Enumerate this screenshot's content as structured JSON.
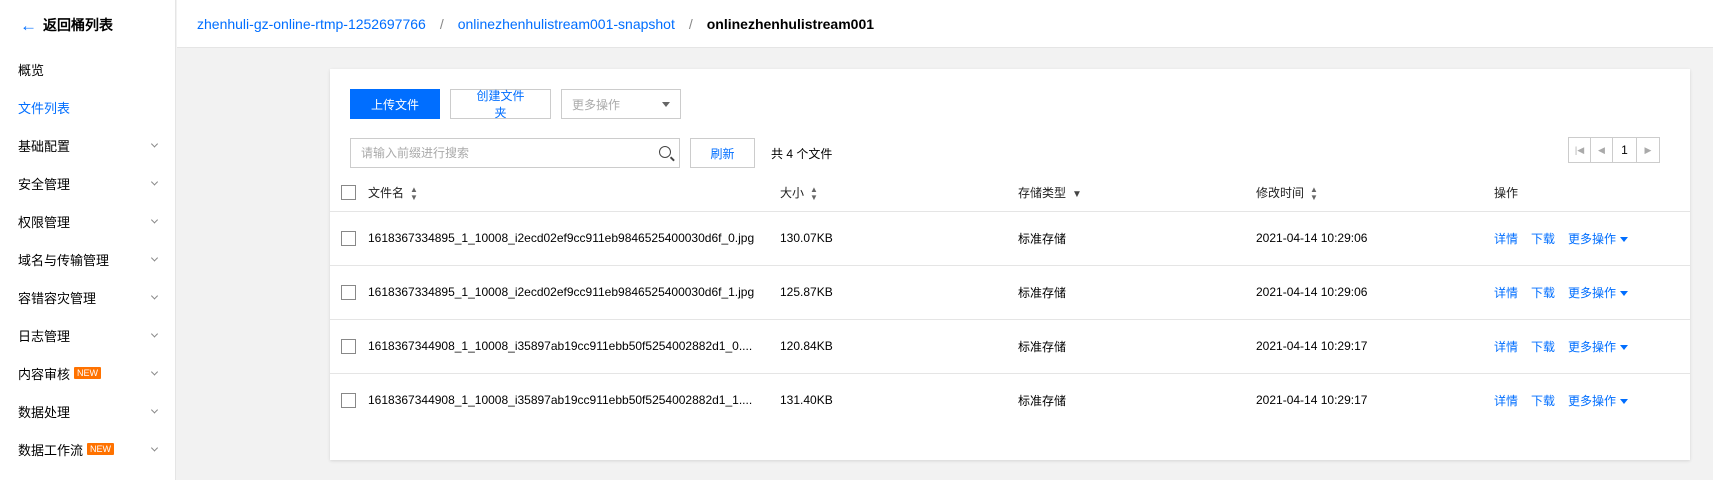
{
  "sidebar": {
    "back_label": "返回桶列表",
    "items": [
      {
        "label": "概览",
        "active": false,
        "expandable": false
      },
      {
        "label": "文件列表",
        "active": true,
        "expandable": false
      },
      {
        "label": "基础配置",
        "active": false,
        "expandable": true
      },
      {
        "label": "安全管理",
        "active": false,
        "expandable": true
      },
      {
        "label": "权限管理",
        "active": false,
        "expandable": true
      },
      {
        "label": "域名与传输管理",
        "active": false,
        "expandable": true
      },
      {
        "label": "容错容灾管理",
        "active": false,
        "expandable": true
      },
      {
        "label": "日志管理",
        "active": false,
        "expandable": true
      },
      {
        "label": "内容审核",
        "active": false,
        "expandable": true,
        "badge": "NEW"
      },
      {
        "label": "数据处理",
        "active": false,
        "expandable": true
      },
      {
        "label": "数据工作流",
        "active": false,
        "expandable": true,
        "badge": "NEW"
      }
    ]
  },
  "breadcrumb": {
    "bucket": "zhenhuli-gz-online-rtmp-1252697766",
    "folder": "onlinezhenhulistream001-snapshot",
    "current": "onlinezhenhulistream001",
    "separator": "/"
  },
  "toolbar": {
    "upload_label": "上传文件",
    "create_folder_label": "创建文件夹",
    "more_ops_placeholder": "更多操作",
    "search_placeholder": "请输入前缀进行搜索",
    "refresh_label": "刷新",
    "file_count_text": "共 4 个文件"
  },
  "pagination": {
    "page": "1"
  },
  "table": {
    "headers": {
      "name": "文件名",
      "size": "大小",
      "storage": "存储类型",
      "modified": "修改时间",
      "actions": "操作"
    },
    "rows": [
      {
        "name": "1618367334895_1_10008_i2ecd02ef9cc911eb9846525400030d6f_0.jpg",
        "size": "130.07KB",
        "storage": "标准存储",
        "modified": "2021-04-14 10:29:06"
      },
      {
        "name": "1618367334895_1_10008_i2ecd02ef9cc911eb9846525400030d6f_1.jpg",
        "size": "125.87KB",
        "storage": "标准存储",
        "modified": "2021-04-14 10:29:06"
      },
      {
        "name": "1618367344908_1_10008_i35897ab19cc911ebb50f5254002882d1_0....",
        "size": "120.84KB",
        "storage": "标准存储",
        "modified": "2021-04-14 10:29:17"
      },
      {
        "name": "1618367344908_1_10008_i35897ab19cc911ebb50f5254002882d1_1....",
        "size": "131.40KB",
        "storage": "标准存储",
        "modified": "2021-04-14 10:29:17"
      }
    ],
    "row_actions": {
      "detail": "详情",
      "download": "下载",
      "more": "更多操作"
    }
  },
  "colors": {
    "accent": "#006eff",
    "badge": "#ff7200",
    "background": "#f2f2f2"
  },
  "icons": {
    "back": "arrow-left-icon",
    "search": "search-icon",
    "sort": "sort-icon",
    "filter": "filter-icon",
    "chevron": "chevron-down-icon"
  }
}
